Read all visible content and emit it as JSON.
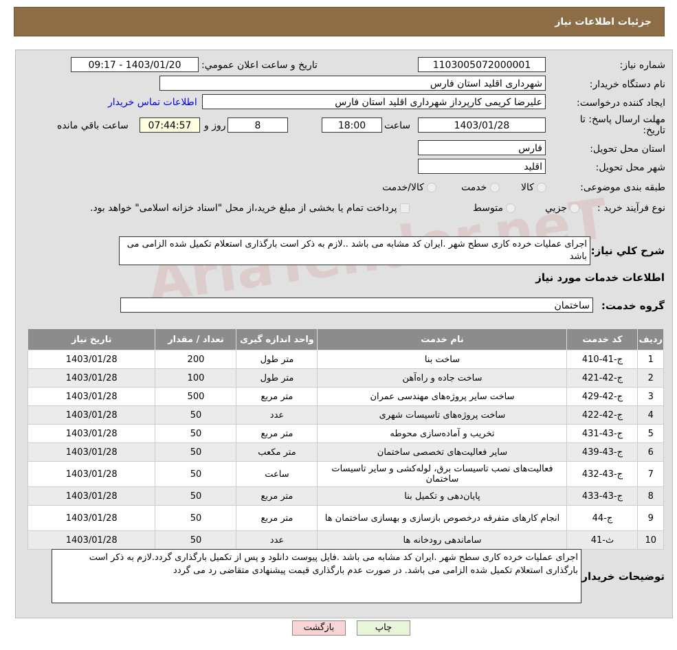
{
  "header": {
    "title": "جزئیات اطلاعات نیاز"
  },
  "form": {
    "need_number_label": "شماره نیاز:",
    "need_number": "1103005072000001",
    "announce_label": "تاریخ و ساعت اعلان عمومي:",
    "announce_value": "1403/01/20 - 09:17",
    "buyer_label": "نام دستگاه خریدار:",
    "buyer": "شهرداری اقلید استان فارس",
    "creator_label": "ایجاد کننده درخواست:",
    "creator": "علیرضا کریمی  کارپرداز شهرداری اقلید استان فارس",
    "contact_link": "اطلاعات تماس خریدار",
    "deadline_label": "مهلت ارسال پاسخ: تا تاریخ:",
    "deadline_date": "1403/01/28",
    "time_label": "ساعت",
    "deadline_time": "18:00",
    "days": "8",
    "days_label": "روز و",
    "remaining": "07:44:57",
    "remaining_label": "ساعت باقي مانده",
    "province_label": "استان محل تحویل:",
    "province": "فارس",
    "city_label": "شهر محل تحویل:",
    "city": "اقلید",
    "category_label": "طبقه بندی موضوعی:",
    "category_options": [
      "کالا",
      "خدمت",
      "کالا/خدمت"
    ],
    "process_label": "نوع فرآیند خرید :",
    "process_options": [
      "جزيي",
      "متوسط"
    ],
    "payment_note": "پرداخت تمام یا بخشی از مبلغ خرید،از محل \"اسناد خزانه اسلامی\" خواهد بود.",
    "summary_label": "شرح كلي نیاز:",
    "summary": "اجرای عملیات خرده کاری سطح شهر .ایران کد مشابه می باشد ..لازم به ذکر است بارگذاری استعلام تکمیل شده الزامی می باشد",
    "services_title": "اطلاعات خدمات مورد نیاز",
    "service_group_label": "گروه خدمت:",
    "service_group": "ساختمان"
  },
  "table": {
    "headers": [
      "ردیف",
      "کد خدمت",
      "نام خدمت",
      "واحد اندازه گیری",
      "تعداد / مقدار",
      "تاریخ نیاز"
    ],
    "rows": [
      [
        "1",
        "ج-41-410",
        "ساخت بنا",
        "متر طول",
        "200",
        "1403/01/28"
      ],
      [
        "2",
        "ج-42-421",
        "ساخت جاده و راه‌آهن",
        "متر طول",
        "100",
        "1403/01/28"
      ],
      [
        "3",
        "ج-42-429",
        "ساخت سایر پروژه‌های مهندسی عمران",
        "متر مربع",
        "500",
        "1403/01/28"
      ],
      [
        "4",
        "ج-42-422",
        "ساخت پروژه‌های تاسیسات شهری",
        "عدد",
        "50",
        "1403/01/28"
      ],
      [
        "5",
        "ج-43-431",
        "تخریب و آماده‌سازی محوطه",
        "متر مربع",
        "50",
        "1403/01/28"
      ],
      [
        "6",
        "ج-43-439",
        "سایر فعالیت‌های تخصصی ساختمان",
        "متر مکعب",
        "50",
        "1403/01/28"
      ],
      [
        "7",
        "ج-43-432",
        "فعالیت‌های نصب تاسیسات برق، لوله‌کشی و سایر تاسیسات ساختمان",
        "ساعت",
        "50",
        "1403/01/28"
      ],
      [
        "8",
        "ج-43-433",
        "پایان‌دهی و تکمیل بنا",
        "متر مربع",
        "50",
        "1403/01/28"
      ],
      [
        "9",
        "ج-44",
        "انجام کارهای متفرقه درخصوص بازسازی و بهسازی ساختمان ها",
        "متر مربع",
        "50",
        "1403/01/28"
      ],
      [
        "10",
        "ث-41",
        "ساماندهی رودخانه ها",
        "عدد",
        "50",
        "1403/01/28"
      ]
    ]
  },
  "buyer_notes": {
    "label": "توضیحات خریدار:",
    "text": "اجرای عملیات خرده کاری سطح شهر .ایران کد مشابه می باشد .فایل پیوست دانلود و پس از تکمیل بارگذاری گردد.لازم به ذکر است بارگذاری استعلام تکمیل شده الزامی می باشد. در صورت عدم بارگذاری قیمت پیشنهادی متقاضی رد می گردد"
  },
  "buttons": {
    "print": "چاپ",
    "back": "بازگشت"
  },
  "watermark": "AriaTender.neT",
  "colors": {
    "header": "#8c6d46",
    "link": "#0000ee",
    "back_button": "#f9d4d4",
    "print_button": "#e8f5d8"
  }
}
